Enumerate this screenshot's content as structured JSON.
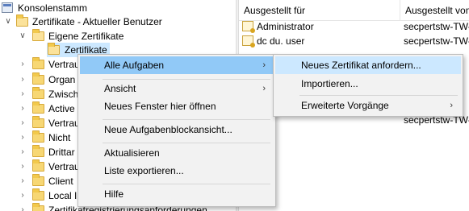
{
  "tree": {
    "root": "Konsolenstamm",
    "store": "Zertifikate - Aktueller Benutzer",
    "eigene": "Eigene Zertifikate",
    "zertifikate": "Zertifikate",
    "partial_items": [
      "Vertrau",
      "Organ",
      "Zwisch",
      "Active",
      "Vertrau",
      "Nicht",
      "Drittar",
      "Vertrau",
      "Client",
      "Local I"
    ],
    "bottom_item": "Zertifikatregistrierungsanforderungen"
  },
  "list": {
    "columns": [
      "Ausgestellt für",
      "Ausgestellt von"
    ],
    "rows": [
      {
        "issued_to": "Administrator",
        "issued_by": "secpertstw-TW-"
      },
      {
        "issued_to": "dc du. user",
        "issued_by": "secpertstw-TW-"
      },
      {
        "issued_to": "",
        "issued_by": "secpertstw-TW-"
      }
    ]
  },
  "context_menu": {
    "items": [
      "Alle Aufgaben",
      "Ansicht",
      "Neues Fenster hier öffnen",
      "Neue Aufgabenblockansicht...",
      "Aktualisieren",
      "Liste exportieren...",
      "Hilfe"
    ]
  },
  "submenu": {
    "items": [
      "Neues Zertifikat anfordern...",
      "Importieren...",
      "Erweiterte Vorgänge"
    ]
  },
  "colors": {
    "menu_highlight": "#91c9f7",
    "selection": "#cce8ff",
    "folder": "#f7d774"
  },
  "icons": [
    "chevron-down-icon",
    "chevron-right-icon",
    "folder-icon",
    "certificate-icon",
    "submenu-arrow-icon"
  ]
}
